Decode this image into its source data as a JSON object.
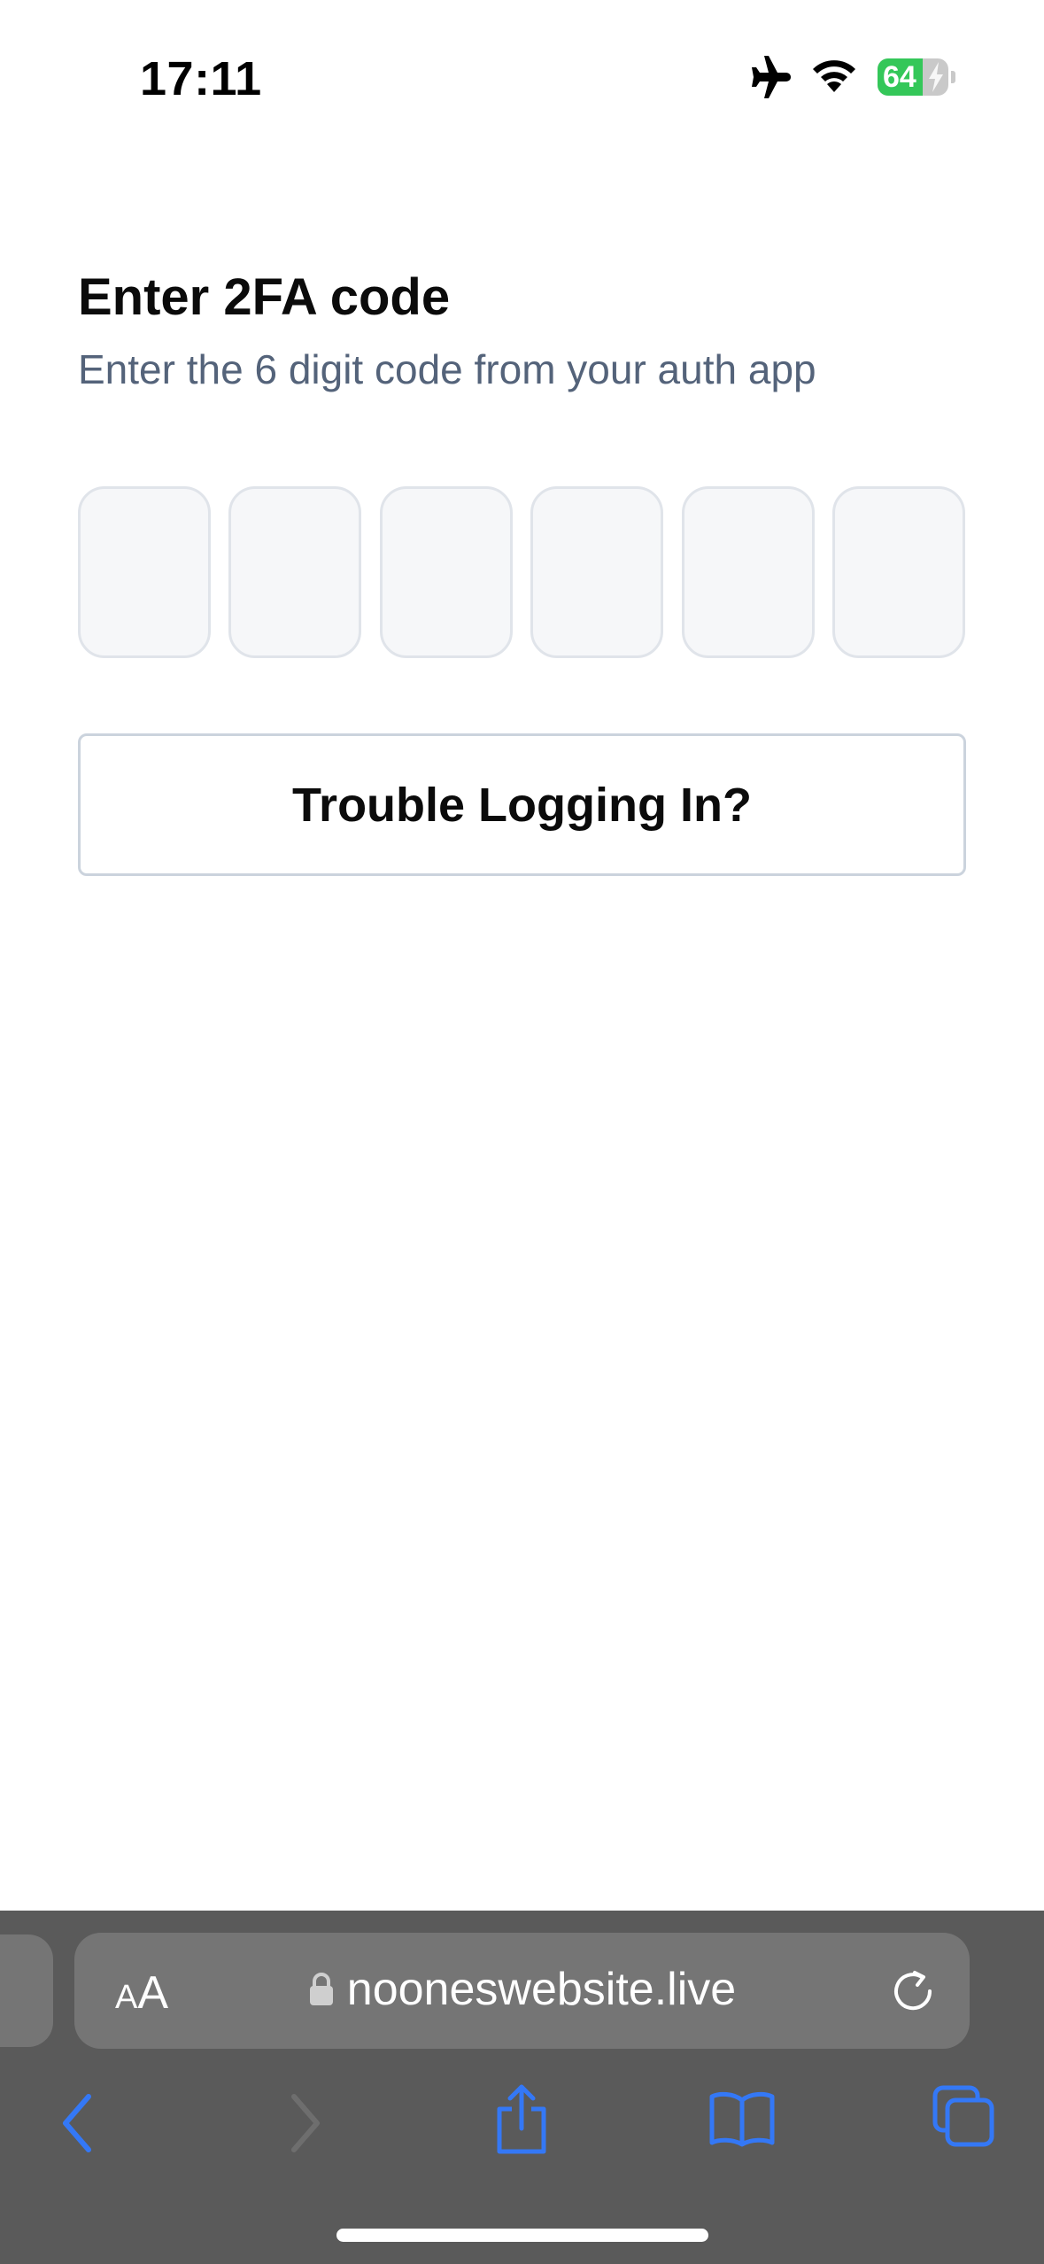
{
  "status_bar": {
    "time": "17:11",
    "battery_level": "64",
    "battery_fraction": 0.64,
    "icons": [
      "airplane-icon",
      "wifi-icon",
      "battery-charging-icon"
    ]
  },
  "main": {
    "title": "Enter 2FA code",
    "subtitle": "Enter the 6 digit code from your auth app",
    "code_digits": [
      "",
      "",
      "",
      "",
      "",
      ""
    ],
    "trouble_button_label": "Trouble Logging In?"
  },
  "browser": {
    "text_size_small": "A",
    "text_size_big": "A",
    "url": "nooneswebsite.live",
    "toolbar_icons": [
      "back-icon",
      "forward-icon",
      "share-icon",
      "bookmarks-icon",
      "tabs-icon"
    ]
  },
  "colors": {
    "accent": "#3478f6",
    "text_primary": "#0b0b0b",
    "text_secondary": "#54637a",
    "browser_chrome": "#5a5a5a",
    "battery_green": "#34c759"
  }
}
